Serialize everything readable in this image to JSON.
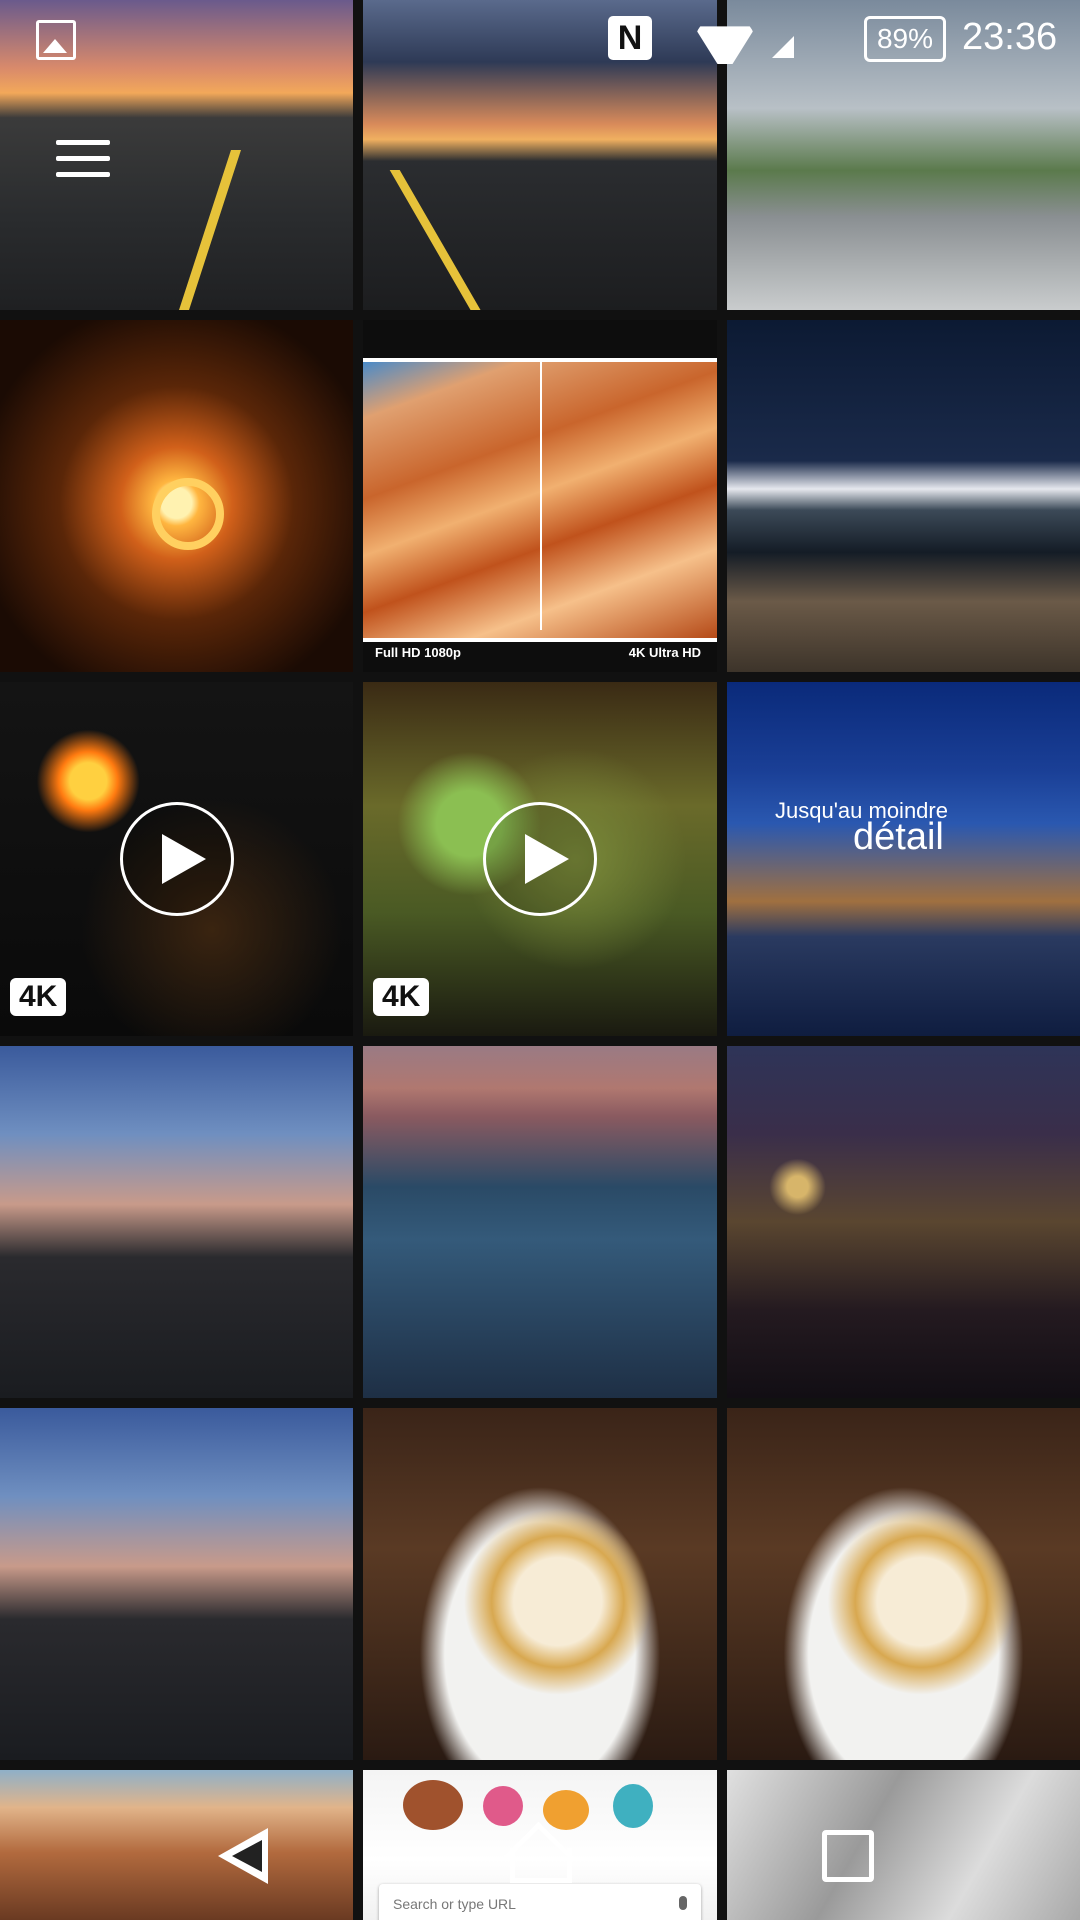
{
  "status_bar": {
    "battery": "89%",
    "time": "23:36",
    "icons": [
      "gallery-icon",
      "nfc-icon",
      "wifi-icon",
      "cell-signal-icon",
      "battery-icon"
    ]
  },
  "tiles": [
    {
      "kind": "photo",
      "name": "road-sunset-photo"
    },
    {
      "kind": "photo",
      "name": "road-sunset-photo-2"
    },
    {
      "kind": "photo",
      "name": "city-street-photo"
    },
    {
      "kind": "photo",
      "name": "tunnel-sparks-photo"
    },
    {
      "kind": "photo",
      "name": "resolution-compare-photo",
      "label_left": "Full HD 1080p",
      "label_right": "4K Ultra HD"
    },
    {
      "kind": "photo",
      "name": "lake-pier-photo"
    },
    {
      "kind": "video",
      "name": "aerial-night-video",
      "badge": "4K"
    },
    {
      "kind": "video",
      "name": "moss-macro-video",
      "badge": "4K"
    },
    {
      "kind": "photo",
      "name": "pittsburgh-night-photo",
      "caption_small": "Jusqu'au moindre",
      "caption_big": "détail"
    },
    {
      "kind": "photo",
      "name": "atlanta-skyline-photo"
    },
    {
      "kind": "photo",
      "name": "las-vegas-photo"
    },
    {
      "kind": "photo",
      "name": "new-york-night-photo"
    },
    {
      "kind": "photo",
      "name": "atlanta-skyline-photo-2"
    },
    {
      "kind": "photo",
      "name": "waffle-dessert-photo"
    },
    {
      "kind": "photo",
      "name": "waffle-dessert-photo-2"
    },
    {
      "kind": "photo",
      "name": "canyon-photo"
    },
    {
      "kind": "photo",
      "name": "browser-screenshot",
      "search_placeholder": "Search or type URL"
    },
    {
      "kind": "photo",
      "name": "marble-photo"
    }
  ],
  "nav_bar": {
    "icons": [
      "back-icon",
      "home-icon",
      "recent-apps-icon"
    ]
  }
}
